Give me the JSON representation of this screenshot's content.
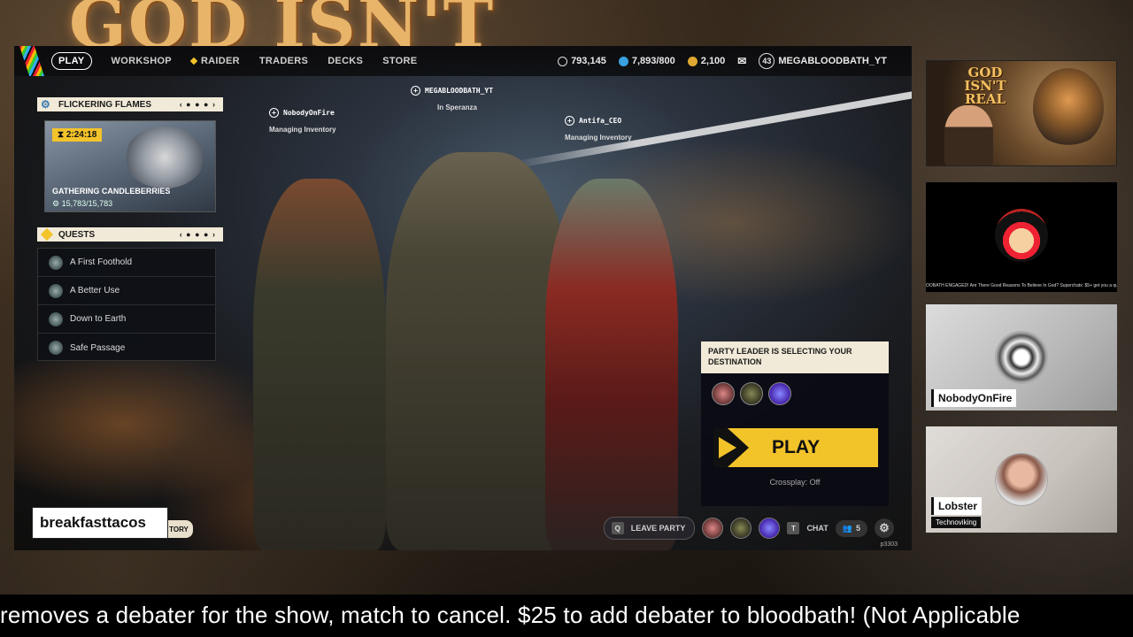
{
  "background": {
    "title": "GOD ISN'T"
  },
  "nav": {
    "items": [
      "PLAY",
      "WORKSHOP",
      "RAIDER",
      "TRADERS",
      "DECKS",
      "STORE"
    ],
    "active": "PLAY"
  },
  "currency": {
    "coins": "793,145",
    "seeds": "7,893/800",
    "tokens": "2,100",
    "level": "43",
    "username": "MEGABLOODBATH_YT"
  },
  "event": {
    "title": "FLICKERING FLAMES",
    "timer": "2:24:18",
    "name": "GATHERING CANDLEBERRIES",
    "count": "15,783/15,783"
  },
  "quests": {
    "title": "QUESTS",
    "items": [
      {
        "label": "A First Foothold"
      },
      {
        "label": "A Better Use"
      },
      {
        "label": "Down to Earth"
      },
      {
        "label": "Safe Passage"
      }
    ]
  },
  "party": {
    "members": [
      {
        "name": "NobodyOnFire",
        "status": "Managing Inventory"
      },
      {
        "name": "MEGABLOODBATH_YT",
        "status": "In Speranza"
      },
      {
        "name": "Antifa_CEO",
        "status": "Managing Inventory"
      }
    ],
    "leader_message": "PARTY LEADER IS SELECTING YOUR DESTINATION",
    "play_label": "PLAY",
    "crossplay": "Crossplay: Off"
  },
  "bottombar": {
    "leave_key": "Q",
    "leave_label": "LEAVE PARTY",
    "chat_key": "T",
    "chat_label": "CHAT",
    "friends_count": "5",
    "build": "p3303"
  },
  "overlay": {
    "streamer": "breakfasttacos",
    "history_partial": "TORY"
  },
  "poster": {
    "title": "GOD ISN'T REAL"
  },
  "cams": {
    "cam1_text": "OOBATH ENGAGED! Are There Good Reasons To Believe In God? Superchats: $5+ get you a questio",
    "cam2_name": "NobodyOnFire",
    "cam3_name": "Lobster",
    "cam3_sub": "Technoviking"
  },
  "ticker": "removes a debater for the show, match to cancel. $25 to add debater to bloodbath! (Not Applicable",
  "colors": {
    "accent": "#f3c32a",
    "panel_header": "#f1ead8"
  }
}
